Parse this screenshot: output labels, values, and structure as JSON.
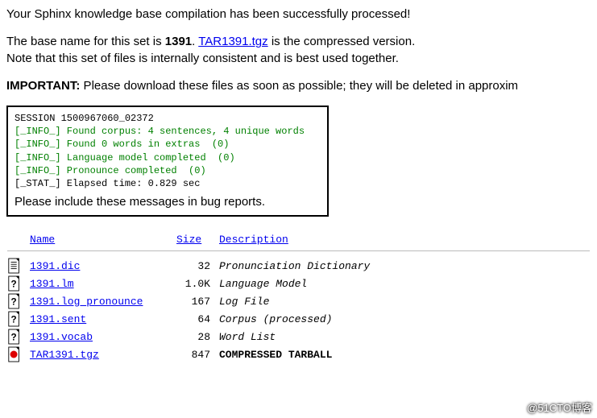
{
  "intro": {
    "success": "Your Sphinx knowledge base compilation has been successfully processed!",
    "base_prefix": "The base name for this set is ",
    "base_name": "1391",
    "period": ". ",
    "tar_link": "TAR1391.tgz",
    "tar_suffix": " is the compressed version.",
    "note": "Note that this set of files is internally consistent and is best used together.",
    "important_label": "IMPORTANT:",
    "important_text": " Please download these files as soon as possible; they will be deleted in approxim"
  },
  "log": {
    "session": "SESSION 1500967060_02372",
    "lines": [
      "[_INFO_] Found corpus: 4 sentences, 4 unique words",
      "[_INFO_] Found 0 words in extras  (0)",
      "[_INFO_] Language model completed  (0)",
      "[_INFO_] Pronounce completed  (0)"
    ],
    "stat": "[_STAT_] Elapsed time: 0.829 sec",
    "include": "Please include these messages in bug reports."
  },
  "table": {
    "headers": {
      "name": "Name",
      "size": "Size",
      "desc": "Description"
    },
    "rows": [
      {
        "icon": "text",
        "name": "1391.dic",
        "size": "32",
        "desc": "Pronunciation Dictionary",
        "bold": false
      },
      {
        "icon": "unknown",
        "name": "1391.lm",
        "size": "1.0K",
        "desc": "Language Model",
        "bold": false
      },
      {
        "icon": "unknown",
        "name": "1391.log_pronounce",
        "size": "167",
        "desc": "Log File",
        "bold": false
      },
      {
        "icon": "unknown",
        "name": "1391.sent",
        "size": "64",
        "desc": "Corpus (processed)",
        "bold": false
      },
      {
        "icon": "unknown",
        "name": "1391.vocab",
        "size": "28",
        "desc": "Word List",
        "bold": false
      },
      {
        "icon": "tar",
        "name": "TAR1391.tgz",
        "size": "847",
        "desc": "COMPRESSED TARBALL",
        "bold": true
      }
    ]
  },
  "watermark": "@51CTO博客",
  "chart_data": {
    "type": "table",
    "title": "Sphinx compilation output files",
    "columns": [
      "Name",
      "Size",
      "Description"
    ],
    "rows": [
      [
        "1391.dic",
        "32",
        "Pronunciation Dictionary"
      ],
      [
        "1391.lm",
        "1.0K",
        "Language Model"
      ],
      [
        "1391.log_pronounce",
        "167",
        "Log File"
      ],
      [
        "1391.sent",
        "64",
        "Corpus (processed)"
      ],
      [
        "1391.vocab",
        "28",
        "Word List"
      ],
      [
        "TAR1391.tgz",
        "847",
        "COMPRESSED TARBALL"
      ]
    ]
  }
}
